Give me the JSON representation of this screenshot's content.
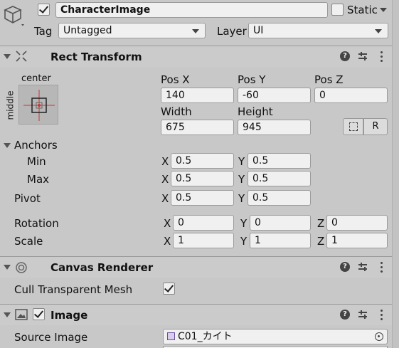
{
  "gameobject": {
    "active": true,
    "name": "CharacterImage",
    "static_label": "Static",
    "static_checked": false,
    "tag_label": "Tag",
    "tag_value": "Untagged",
    "layer_label": "Layer",
    "layer_value": "UI"
  },
  "rect_transform": {
    "title": "Rect Transform",
    "anchor_preset_top": "center",
    "anchor_preset_side": "middle",
    "pos_x_label": "Pos X",
    "pos_y_label": "Pos Y",
    "pos_z_label": "Pos Z",
    "pos_x": "140",
    "pos_y": "-60",
    "pos_z": "0",
    "width_label": "Width",
    "height_label": "Height",
    "width": "675",
    "height": "945",
    "raw_edit_label": "R",
    "anchors_label": "Anchors",
    "min_label": "Min",
    "max_label": "Max",
    "min_x": "0.5",
    "min_y": "0.5",
    "max_x": "0.5",
    "max_y": "0.5",
    "pivot_label": "Pivot",
    "pivot_x": "0.5",
    "pivot_y": "0.5",
    "rotation_label": "Rotation",
    "rot_x": "0",
    "rot_y": "0",
    "rot_z": "0",
    "scale_label": "Scale",
    "scale_x": "1",
    "scale_y": "1",
    "scale_z": "1",
    "axis_x": "X",
    "axis_y": "Y",
    "axis_z": "Z"
  },
  "canvas_renderer": {
    "title": "Canvas Renderer",
    "cull_label": "Cull Transparent Mesh",
    "cull_checked": true
  },
  "image": {
    "title": "Image",
    "enabled": true,
    "source_label": "Source Image",
    "source_value": "C01_カイト"
  }
}
